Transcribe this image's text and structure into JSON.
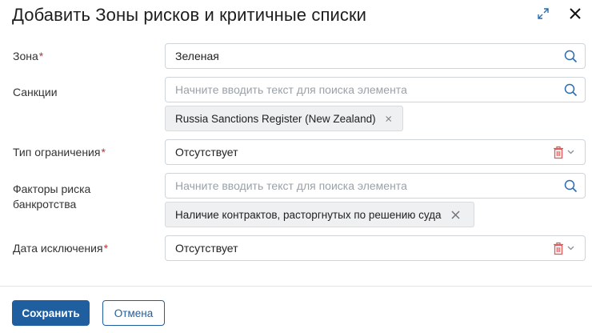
{
  "dialog": {
    "title": "Добавить Зоны рисков и критичные списки"
  },
  "form": {
    "zone": {
      "label": "Зона",
      "required_mark": "*",
      "value": "Зеленая"
    },
    "sanctions": {
      "label": "Санкции",
      "placeholder": "Начните вводить текст для поиска элемента",
      "chips": [
        "Russia Sanctions Register (New Zealand)"
      ]
    },
    "restriction_type": {
      "label": "Тип ограничения",
      "required_mark": "*",
      "value": "Отсутствует"
    },
    "bankruptcy_factors": {
      "label_line1": "Факторы риска",
      "label_line2": "банкротства",
      "placeholder": "Начните вводить текст для поиска элемента",
      "chips": [
        "Наличие контрактов, расторгнутых по решению суда"
      ]
    },
    "exclusion_date": {
      "label": "Дата исключения",
      "required_mark": "*",
      "value": "Отсутствует"
    }
  },
  "footer": {
    "save_label": "Сохранить",
    "cancel_label": "Отмена"
  },
  "colors": {
    "primary": "#1f5fa0",
    "required": "#d9262c",
    "trash": "#e05a5a",
    "search_icon": "#2a6cb0"
  }
}
